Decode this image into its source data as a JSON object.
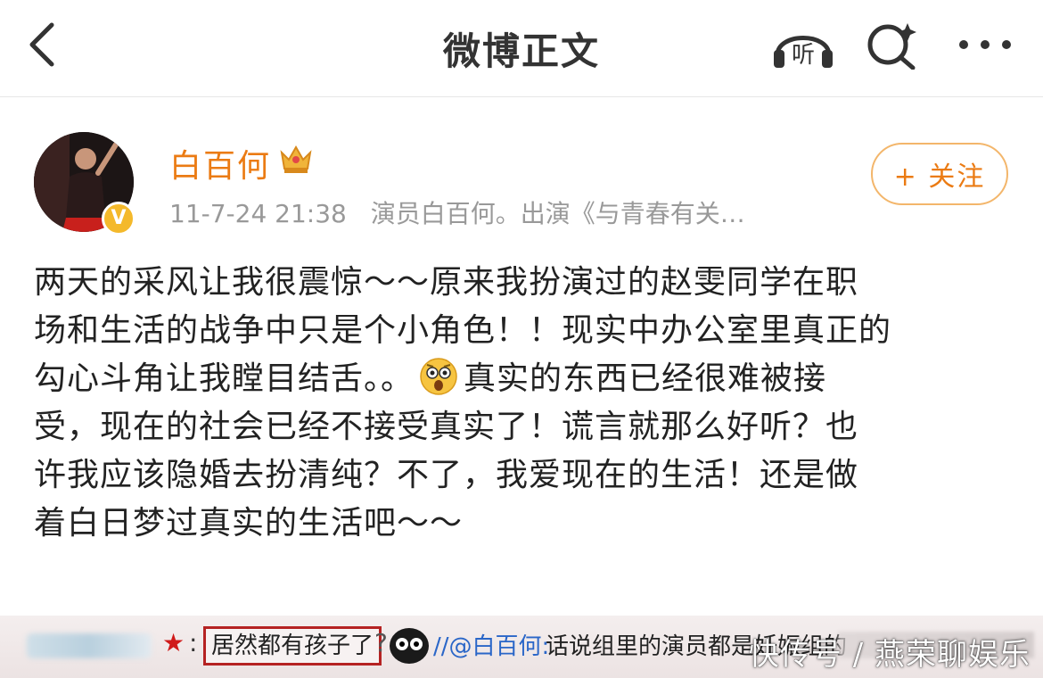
{
  "header": {
    "title": "微博正文",
    "listen_label": "听"
  },
  "post": {
    "author": "白百何",
    "timestamp": "11-7-24 21:38",
    "bio": "演员白百何。出演《与青春有关…",
    "follow_label": "+ 关注",
    "verified_badge": "V",
    "text_lines": [
      "两天的采风让我很震惊～～原来我扮演过的赵雯同学在职",
      "场和生活的战争中只是个小角色！！现实中办公室里真正的",
      "勾心斗角让我瞠目结舌。。",
      "真实的东西已经很难被接",
      "受，现在的社会已经不接受真实了！谎言就那么好听？也",
      "许我应该隐婚去扮清纯？不了，我爱现在的生活！还是做",
      "着白日梦过真实的生活吧～～"
    ]
  },
  "comment_strip": {
    "star": "★",
    "colon": ":",
    "boxed_text": "居然都有孩子了",
    "question": "?",
    "reply_prefix": "//@白百何:",
    "reply_text": "话说组里的演员都是妊娠组的"
  },
  "watermark": "快传号 / 燕荣聊娱乐",
  "colors": {
    "accent_orange": "#eb7b13",
    "follow_border": "#f3b66b",
    "verified_gold": "#f4b92b",
    "highlight_red": "#b52222",
    "link_blue": "#2a66c8"
  },
  "icons": [
    "back-arrow-icon",
    "headphones-listen-icon",
    "search-sparkle-icon",
    "more-dots-icon",
    "crown-icon",
    "verified-v-icon",
    "shocked-face-emoji"
  ]
}
